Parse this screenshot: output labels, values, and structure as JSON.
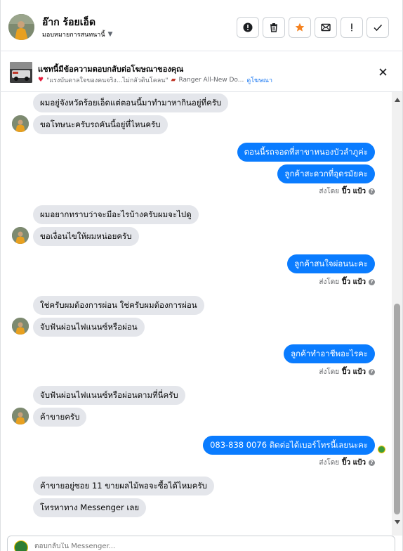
{
  "header": {
    "contact_name": "อ๊าก ร้อยเอ็ด",
    "assignee_label": "มอบหมายการสนทนานี้",
    "actions": [
      {
        "name": "mark-spam-button",
        "icon": "alert-circle-icon"
      },
      {
        "name": "delete-button",
        "icon": "trash-icon"
      },
      {
        "name": "star-button",
        "icon": "star-icon"
      },
      {
        "name": "mark-unread-button",
        "icon": "envelope-icon"
      },
      {
        "name": "report-button",
        "icon": "exclamation-icon"
      },
      {
        "name": "done-button",
        "icon": "checkmark-icon"
      }
    ],
    "colors": {
      "star": "#f5821f",
      "border": "#ccd0d5"
    }
  },
  "ad_banner": {
    "title": "แชทนี้มีข้อความตอบกลับต่อโฆษณาของคุณ",
    "ad_text": "\"แรงบันดาลใจของคนจริง...ไม่กลัวดินโคลน\"",
    "ad_text_2": "Ranger All-New Do...",
    "view_ad_link": "ดูโฆษณา"
  },
  "messages": [
    {
      "dir": "in",
      "text": "ผมอยู่จังหวัดร้อยเอ็ดแต่ตอนนี้มาทำมาหากินอยู่ที่ครับ"
    },
    {
      "dir": "in",
      "text": "ขอโทษนะครับรถคันนี้อยู่ที่ไหนครับ"
    },
    {
      "dir": "out",
      "text": "ตอนนี้รถจอดที่สาขาหนองบัวลำภูค่ะ"
    },
    {
      "dir": "out",
      "text": "ลูกค้าสะดวกที่อุดรมัยคะ"
    },
    {
      "dir": "in",
      "text": "ผมอยากทราบว่าจะมีอะไรบ้างครับผมจะไปดู"
    },
    {
      "dir": "in",
      "text": "ขอเงื่อนไขให้ผมหน่อยครับ"
    },
    {
      "dir": "out",
      "text": "ลูกค้าสนใจผ่อนนะคะ"
    },
    {
      "dir": "in",
      "text": "ใช่ครับผมต้องการผ่อน ใช่ครับผมต้องการผ่อน"
    },
    {
      "dir": "in",
      "text": "จับฟันผ่อนไฟแนนซ์หรือผ่อน"
    },
    {
      "dir": "out",
      "text": "ลูกค้าทำอาชีพอะไรคะ"
    },
    {
      "dir": "in",
      "text": "จับฟันผ่อนไฟแนนซ์หรือผ่อนตามที่นี่ครับ"
    },
    {
      "dir": "in",
      "text": "ค้าขายครับ"
    },
    {
      "dir": "out",
      "text": "083-838 0076  ติดต่อได้เบอร์โทรนี้เลยนะคะ"
    },
    {
      "dir": "in",
      "text": "ค้าขายอยู่ซอย 11 ขายผลไม้พอจะซื้อได้ไหมครับ"
    },
    {
      "dir": "in",
      "text": "โทรหาทาง Messenger เลย"
    }
  ],
  "sent_by": {
    "prefix": "ส่งโดย",
    "name": "ปิ๊ว แป้ว",
    "info": "?"
  },
  "composer": {
    "placeholder": "ตอบกลับใน Messenger..."
  }
}
